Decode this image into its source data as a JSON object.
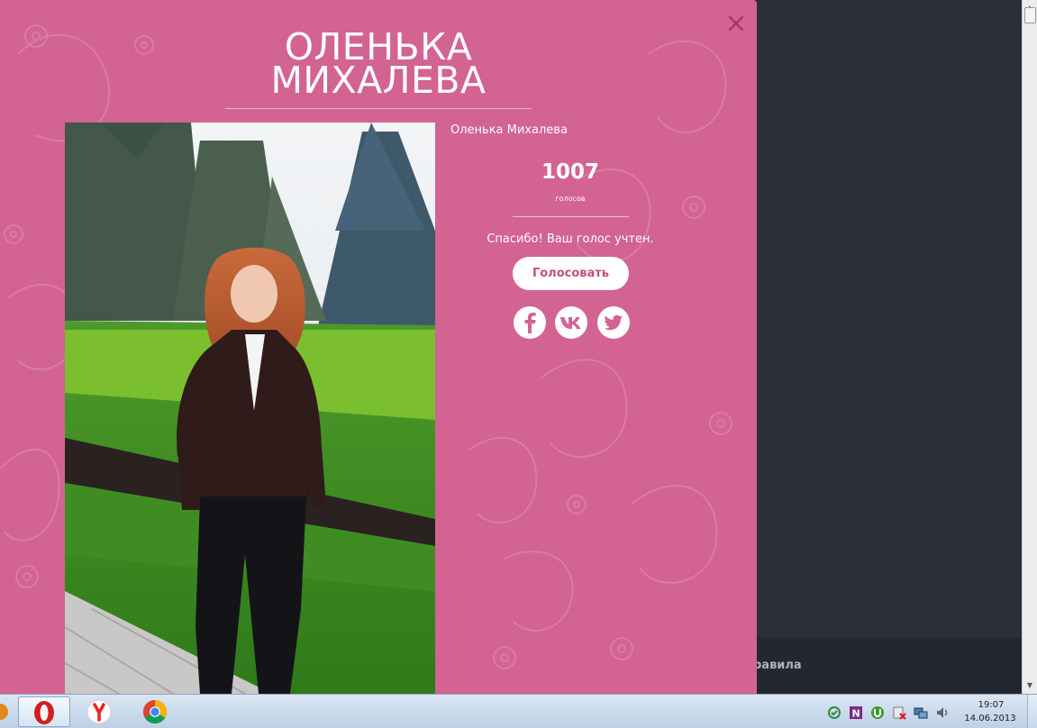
{
  "background_page": {
    "footer_link": "равила"
  },
  "modal": {
    "title_line1": "ОЛЕНЬКА",
    "title_line2": "МИХАЛЕВА",
    "participant_name": "Оленька Михалева",
    "votes_count": "1007",
    "votes_label": "голосов",
    "thanks_text": "Спасибо! Ваш голос учтен.",
    "vote_button_label": "Голосовать",
    "share_icons": [
      "facebook-icon",
      "vk-icon",
      "twitter-icon"
    ],
    "colors": {
      "background": "#d26392",
      "accent": "#c24d82"
    }
  },
  "taskbar": {
    "apps": [
      "opera-icon",
      "yandex-browser-icon",
      "chrome-icon"
    ],
    "clock_time": "19:07",
    "clock_date": "14.06.2013"
  }
}
